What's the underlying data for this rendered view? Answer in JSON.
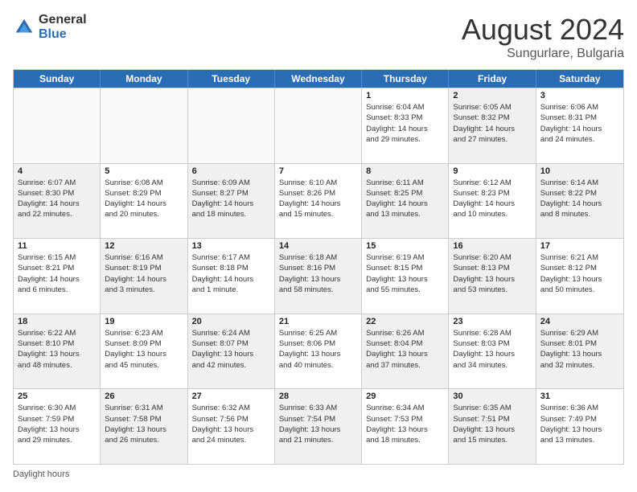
{
  "logo": {
    "general": "General",
    "blue": "Blue"
  },
  "header": {
    "month": "August 2024",
    "location": "Sungurlare, Bulgaria"
  },
  "days": [
    "Sunday",
    "Monday",
    "Tuesday",
    "Wednesday",
    "Thursday",
    "Friday",
    "Saturday"
  ],
  "footer": "Daylight hours",
  "weeks": [
    [
      {
        "day": "",
        "content": "",
        "shaded": false
      },
      {
        "day": "",
        "content": "",
        "shaded": false
      },
      {
        "day": "",
        "content": "",
        "shaded": false
      },
      {
        "day": "",
        "content": "",
        "shaded": false
      },
      {
        "day": "1",
        "content": "Sunrise: 6:04 AM\nSunset: 8:33 PM\nDaylight: 14 hours\nand 29 minutes.",
        "shaded": false
      },
      {
        "day": "2",
        "content": "Sunrise: 6:05 AM\nSunset: 8:32 PM\nDaylight: 14 hours\nand 27 minutes.",
        "shaded": true
      },
      {
        "day": "3",
        "content": "Sunrise: 6:06 AM\nSunset: 8:31 PM\nDaylight: 14 hours\nand 24 minutes.",
        "shaded": false
      }
    ],
    [
      {
        "day": "4",
        "content": "Sunrise: 6:07 AM\nSunset: 8:30 PM\nDaylight: 14 hours\nand 22 minutes.",
        "shaded": true
      },
      {
        "day": "5",
        "content": "Sunrise: 6:08 AM\nSunset: 8:29 PM\nDaylight: 14 hours\nand 20 minutes.",
        "shaded": false
      },
      {
        "day": "6",
        "content": "Sunrise: 6:09 AM\nSunset: 8:27 PM\nDaylight: 14 hours\nand 18 minutes.",
        "shaded": true
      },
      {
        "day": "7",
        "content": "Sunrise: 6:10 AM\nSunset: 8:26 PM\nDaylight: 14 hours\nand 15 minutes.",
        "shaded": false
      },
      {
        "day": "8",
        "content": "Sunrise: 6:11 AM\nSunset: 8:25 PM\nDaylight: 14 hours\nand 13 minutes.",
        "shaded": true
      },
      {
        "day": "9",
        "content": "Sunrise: 6:12 AM\nSunset: 8:23 PM\nDaylight: 14 hours\nand 10 minutes.",
        "shaded": false
      },
      {
        "day": "10",
        "content": "Sunrise: 6:14 AM\nSunset: 8:22 PM\nDaylight: 14 hours\nand 8 minutes.",
        "shaded": true
      }
    ],
    [
      {
        "day": "11",
        "content": "Sunrise: 6:15 AM\nSunset: 8:21 PM\nDaylight: 14 hours\nand 6 minutes.",
        "shaded": false
      },
      {
        "day": "12",
        "content": "Sunrise: 6:16 AM\nSunset: 8:19 PM\nDaylight: 14 hours\nand 3 minutes.",
        "shaded": true
      },
      {
        "day": "13",
        "content": "Sunrise: 6:17 AM\nSunset: 8:18 PM\nDaylight: 14 hours\nand 1 minute.",
        "shaded": false
      },
      {
        "day": "14",
        "content": "Sunrise: 6:18 AM\nSunset: 8:16 PM\nDaylight: 13 hours\nand 58 minutes.",
        "shaded": true
      },
      {
        "day": "15",
        "content": "Sunrise: 6:19 AM\nSunset: 8:15 PM\nDaylight: 13 hours\nand 55 minutes.",
        "shaded": false
      },
      {
        "day": "16",
        "content": "Sunrise: 6:20 AM\nSunset: 8:13 PM\nDaylight: 13 hours\nand 53 minutes.",
        "shaded": true
      },
      {
        "day": "17",
        "content": "Sunrise: 6:21 AM\nSunset: 8:12 PM\nDaylight: 13 hours\nand 50 minutes.",
        "shaded": false
      }
    ],
    [
      {
        "day": "18",
        "content": "Sunrise: 6:22 AM\nSunset: 8:10 PM\nDaylight: 13 hours\nand 48 minutes.",
        "shaded": true
      },
      {
        "day": "19",
        "content": "Sunrise: 6:23 AM\nSunset: 8:09 PM\nDaylight: 13 hours\nand 45 minutes.",
        "shaded": false
      },
      {
        "day": "20",
        "content": "Sunrise: 6:24 AM\nSunset: 8:07 PM\nDaylight: 13 hours\nand 42 minutes.",
        "shaded": true
      },
      {
        "day": "21",
        "content": "Sunrise: 6:25 AM\nSunset: 8:06 PM\nDaylight: 13 hours\nand 40 minutes.",
        "shaded": false
      },
      {
        "day": "22",
        "content": "Sunrise: 6:26 AM\nSunset: 8:04 PM\nDaylight: 13 hours\nand 37 minutes.",
        "shaded": true
      },
      {
        "day": "23",
        "content": "Sunrise: 6:28 AM\nSunset: 8:03 PM\nDaylight: 13 hours\nand 34 minutes.",
        "shaded": false
      },
      {
        "day": "24",
        "content": "Sunrise: 6:29 AM\nSunset: 8:01 PM\nDaylight: 13 hours\nand 32 minutes.",
        "shaded": true
      }
    ],
    [
      {
        "day": "25",
        "content": "Sunrise: 6:30 AM\nSunset: 7:59 PM\nDaylight: 13 hours\nand 29 minutes.",
        "shaded": false
      },
      {
        "day": "26",
        "content": "Sunrise: 6:31 AM\nSunset: 7:58 PM\nDaylight: 13 hours\nand 26 minutes.",
        "shaded": true
      },
      {
        "day": "27",
        "content": "Sunrise: 6:32 AM\nSunset: 7:56 PM\nDaylight: 13 hours\nand 24 minutes.",
        "shaded": false
      },
      {
        "day": "28",
        "content": "Sunrise: 6:33 AM\nSunset: 7:54 PM\nDaylight: 13 hours\nand 21 minutes.",
        "shaded": true
      },
      {
        "day": "29",
        "content": "Sunrise: 6:34 AM\nSunset: 7:53 PM\nDaylight: 13 hours\nand 18 minutes.",
        "shaded": false
      },
      {
        "day": "30",
        "content": "Sunrise: 6:35 AM\nSunset: 7:51 PM\nDaylight: 13 hours\nand 15 minutes.",
        "shaded": true
      },
      {
        "day": "31",
        "content": "Sunrise: 6:36 AM\nSunset: 7:49 PM\nDaylight: 13 hours\nand 13 minutes.",
        "shaded": false
      }
    ]
  ]
}
